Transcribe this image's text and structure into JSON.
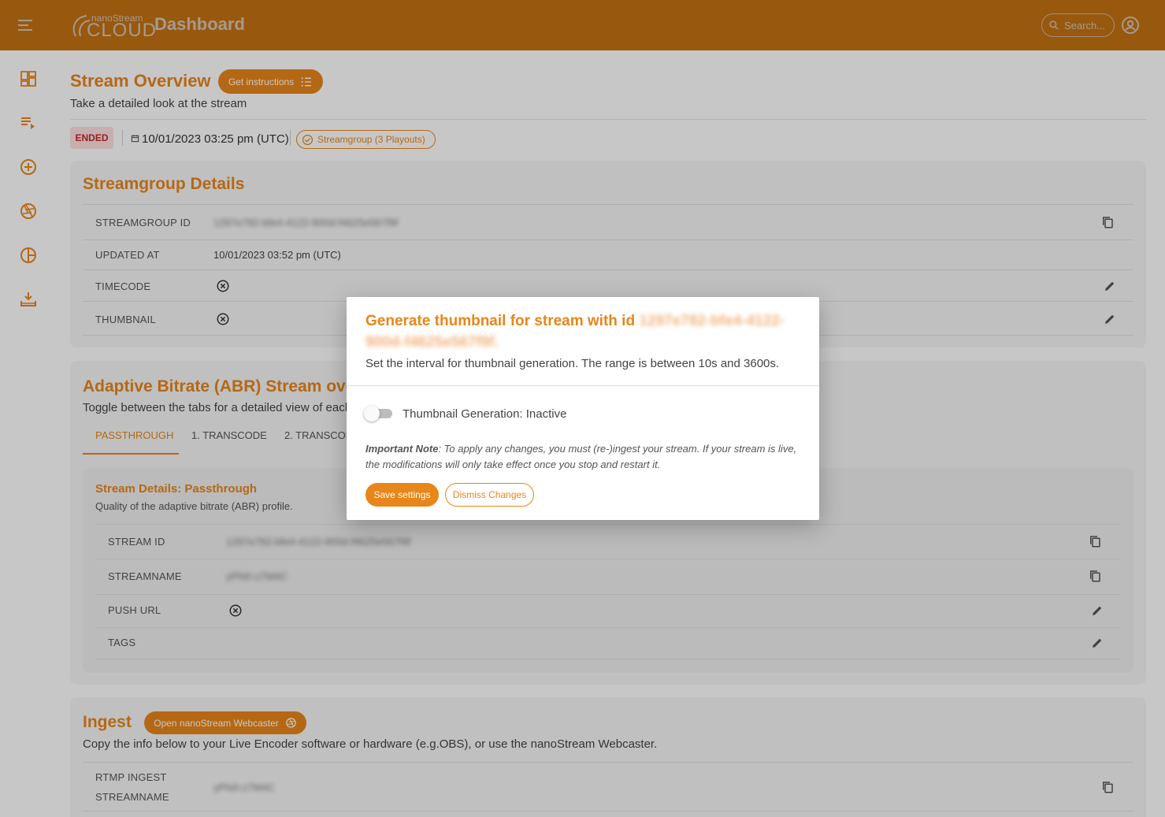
{
  "header": {
    "logo_small": "nanoStream",
    "logo_big": "CLOUD",
    "title": "Dashboard",
    "search_placeholder": "Search..."
  },
  "sidebar": {
    "items": [
      {
        "icon": "dashboard-icon"
      },
      {
        "icon": "playlist-icon"
      },
      {
        "icon": "add-circle-icon"
      },
      {
        "icon": "shutter-icon"
      },
      {
        "icon": "analytics-icon"
      },
      {
        "icon": "download-tray-icon"
      }
    ]
  },
  "overview": {
    "title": "Stream Overview",
    "instructions_label": "Get instructions",
    "subtitle": "Take a detailed look at the stream",
    "status": "ENDED",
    "date": "10/01/2023 03:25 pm (UTC)",
    "streamgroup_chip": "Streamgroup (3 Playouts)"
  },
  "streamgroup": {
    "title": "Streamgroup Details",
    "rows": [
      {
        "label": "STREAMGROUP ID",
        "value": "1297e782-bfe4-4122-900d-f4625e567f9f"
      },
      {
        "label": "UPDATED AT",
        "value": "10/01/2023 03:52 pm (UTC)"
      },
      {
        "label": "TIMECODE",
        "value": ""
      },
      {
        "label": "THUMBNAIL",
        "value": ""
      }
    ]
  },
  "abr": {
    "title": "Adaptive Bitrate (ABR) Stream overview",
    "subtitle": "Toggle between the tabs for a detailed view of each profile.",
    "tabs": [
      "PASSTHROUGH",
      "1. TRANSCODE",
      "2. TRANSCODE"
    ],
    "details": {
      "title": "Stream Details: Passthrough",
      "subtitle": "Quality of the adaptive bitrate (ABR) profile.",
      "rows": [
        {
          "label": "STREAM ID",
          "value": "1297e782-bfe4-4122-900d-f4625e567f9f"
        },
        {
          "label": "STREAMNAME",
          "value": "yPhi0-z7M4C"
        },
        {
          "label": "PUSH URL",
          "value": ""
        },
        {
          "label": "TAGS",
          "value": ""
        }
      ]
    }
  },
  "ingest": {
    "title": "Ingest",
    "webcaster_label": "Open nanoStream Webcaster",
    "subtitle": "Copy the info below to your Live Encoder software or hardware (e.g.OBS), or use the nanoStream Webcaster.",
    "rows": [
      {
        "label_line1": "RTMP INGEST",
        "label_line2": "STREAMNAME",
        "value": "yPhi0-z7M4C"
      }
    ]
  },
  "modal": {
    "title_prefix": "Generate thumbnail for stream with id ",
    "title_id": "1297e782-bfe4-4122-900d-f4625e567f9f.",
    "subtitle": "Set the interval for thumbnail generation. The range is between 10s and 3600s.",
    "toggle_label": "Thumbnail Generation: Inactive",
    "note_bold": "Important Note",
    "note_text": ": To apply any changes, you must (re-)ingest your stream. If your stream is live, the modifications will only take effect once you stop and restart it.",
    "save_label": "Save settings",
    "dismiss_label": "Dismiss Changes"
  },
  "colors": {
    "brand": "#e8861a",
    "ended_bg": "#fde0e0",
    "ended_text": "#c62828"
  }
}
